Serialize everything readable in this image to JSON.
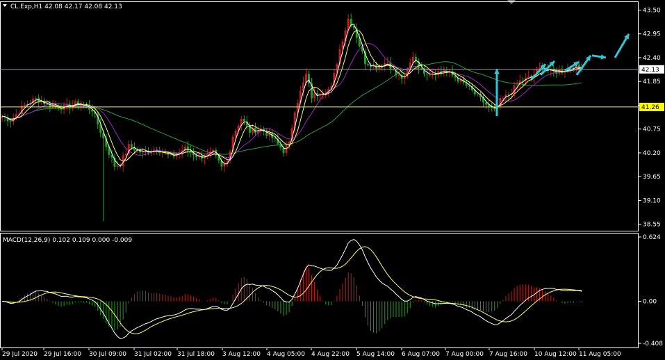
{
  "header": {
    "symbol_line": "CL.Exp,H1  42.08 42.17 42.08 42.13",
    "macd_line": "MACD(12,26,9) 0.102 0.109 0.000 -0.009"
  },
  "colors": {
    "background": "#000000",
    "grid_border": "#ffffff",
    "bull_candle": "#c0201e",
    "bear_candle": "#1fa31f",
    "ma_fast": "#ffffff",
    "ma_mid": "#ffff66",
    "ma_slow": "#9b27c6",
    "ma_long": "#2a9d55",
    "support_line": "#ffff00",
    "price_line": "#8a9bb0",
    "arrow": "#33c6d8",
    "macd_hist_pos": "#c0201e",
    "macd_hist_neg": "#1fa31f",
    "macd_line": "#ffffff",
    "signal_line": "#ffff66"
  },
  "chart_data": {
    "type": "candlestick",
    "price_axis": {
      "ylim": [
        38.4,
        43.7
      ],
      "ticks": [
        "43.50",
        "42.95",
        "42.40",
        "41.85",
        "41.30",
        "40.75",
        "40.20",
        "39.65",
        "39.10",
        "38.55"
      ],
      "tick_values": [
        43.5,
        42.95,
        42.4,
        41.85,
        41.3,
        40.75,
        40.2,
        39.65,
        39.1,
        38.55
      ]
    },
    "current_price_label": "42.13",
    "current_price": 42.13,
    "support_label": "41.26",
    "support_price": 41.26,
    "time_labels": [
      "29 Jul 2020",
      "29 Jul 16:00",
      "30 Jul 09:00",
      "31 Jul 02:00",
      "31 Jul 18:00",
      "3 Aug 12:00",
      "4 Aug 05:00",
      "4 Aug 22:00",
      "5 Aug 14:00",
      "6 Aug 07:00",
      "7 Aug 00:00",
      "7 Aug 16:00",
      "10 Aug 12:00",
      "11 Aug 05:00"
    ],
    "anchors": [
      [
        0,
        41.05
      ],
      [
        3,
        40.95
      ],
      [
        8,
        41.3
      ],
      [
        12,
        41.45
      ],
      [
        17,
        41.3
      ],
      [
        22,
        41.25
      ],
      [
        27,
        41.35
      ],
      [
        32,
        41.2
      ],
      [
        35,
        40.7
      ],
      [
        38,
        40.2
      ],
      [
        40,
        39.9
      ],
      [
        42,
        39.95
      ],
      [
        45,
        40.35
      ],
      [
        50,
        40.2
      ],
      [
        55,
        40.3
      ],
      [
        60,
        40.1
      ],
      [
        65,
        40.3
      ],
      [
        70,
        40.1
      ],
      [
        75,
        40.2
      ],
      [
        78,
        39.85
      ],
      [
        80,
        40.0
      ],
      [
        82,
        40.6
      ],
      [
        85,
        41.0
      ],
      [
        88,
        40.7
      ],
      [
        92,
        40.75
      ],
      [
        96,
        40.55
      ],
      [
        100,
        40.25
      ],
      [
        102,
        40.4
      ],
      [
        104,
        41.2
      ],
      [
        106,
        41.6
      ],
      [
        108,
        42.0
      ],
      [
        110,
        41.5
      ],
      [
        113,
        41.6
      ],
      [
        117,
        41.7
      ],
      [
        120,
        42.6
      ],
      [
        123,
        43.3
      ],
      [
        125,
        43.1
      ],
      [
        127,
        42.7
      ],
      [
        129,
        42.3
      ],
      [
        133,
        42.2
      ],
      [
        137,
        42.3
      ],
      [
        140,
        42.0
      ],
      [
        143,
        41.9
      ],
      [
        146,
        42.45
      ],
      [
        149,
        42.1
      ],
      [
        153,
        42.05
      ],
      [
        157,
        42.1
      ],
      [
        161,
        41.95
      ],
      [
        165,
        41.75
      ],
      [
        169,
        41.5
      ],
      [
        173,
        41.25
      ],
      [
        175,
        41.15
      ],
      [
        177,
        41.4
      ],
      [
        180,
        41.55
      ],
      [
        184,
        41.85
      ],
      [
        188,
        41.95
      ],
      [
        192,
        42.2
      ],
      [
        195,
        42.05
      ],
      [
        199,
        42.1
      ],
      [
        203,
        42.2
      ],
      [
        206,
        42.13
      ]
    ],
    "projection_arrows_prices": [
      [
        41.05,
        42.14
      ],
      [
        41.9,
        42.25
      ],
      [
        42.0,
        42.32
      ],
      [
        42.1,
        42.3
      ],
      [
        42.0,
        42.45
      ],
      [
        42.45,
        42.4
      ],
      [
        42.4,
        42.95
      ]
    ],
    "macd_axis": {
      "ylim": [
        -0.408,
        0.624
      ],
      "ticks": [
        "0.624",
        "0.00",
        "-0.408"
      ],
      "tick_values": [
        0.624,
        0.0,
        -0.408
      ]
    }
  }
}
